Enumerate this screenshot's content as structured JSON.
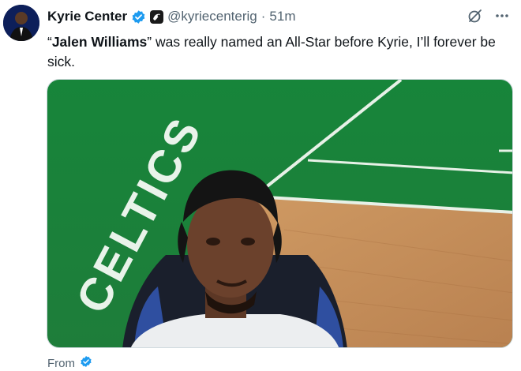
{
  "author": {
    "display_name": "Kyrie Center",
    "handle": "@kyriecenterig",
    "separator": "·",
    "time": "51m"
  },
  "tweet": {
    "quote_open": "“",
    "bold_name": "Jalen Williams",
    "quote_close": "”",
    "rest": " was really named an All-Star before Kyrie, I’ll forever be sick."
  },
  "media": {
    "court_text": "CELTICS"
  },
  "footer": {
    "from_label": "From"
  },
  "colors": {
    "verified_blue": "#1d9bf0",
    "court_green": "#1f8a3a",
    "hardwood": "#c9925a",
    "secondary_text": "#536471"
  },
  "icons": [
    "verified-icon",
    "affiliate-badge-icon",
    "grok-icon",
    "more-icon"
  ]
}
